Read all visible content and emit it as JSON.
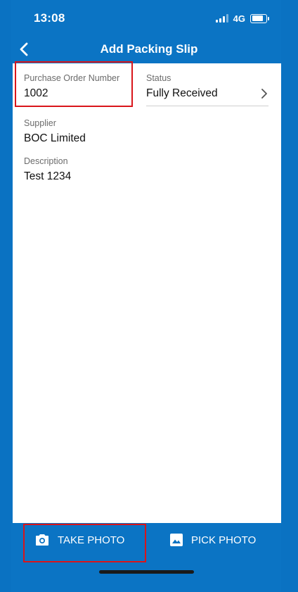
{
  "status_bar": {
    "time": "13:08",
    "network": "4G"
  },
  "nav": {
    "title": "Add Packing Slip"
  },
  "form": {
    "po_label": "Purchase Order Number",
    "po_value": "1002",
    "status_label": "Status",
    "status_value": "Fully Received",
    "supplier_label": "Supplier",
    "supplier_value": "BOC Limited",
    "description_label": "Description",
    "description_value": "Test 1234"
  },
  "toolbar": {
    "take_photo_label": "TAKE PHOTO",
    "pick_photo_label": "PICK PHOTO"
  },
  "colors": {
    "primary": "#0a72c2",
    "highlight": "#d9151b"
  }
}
